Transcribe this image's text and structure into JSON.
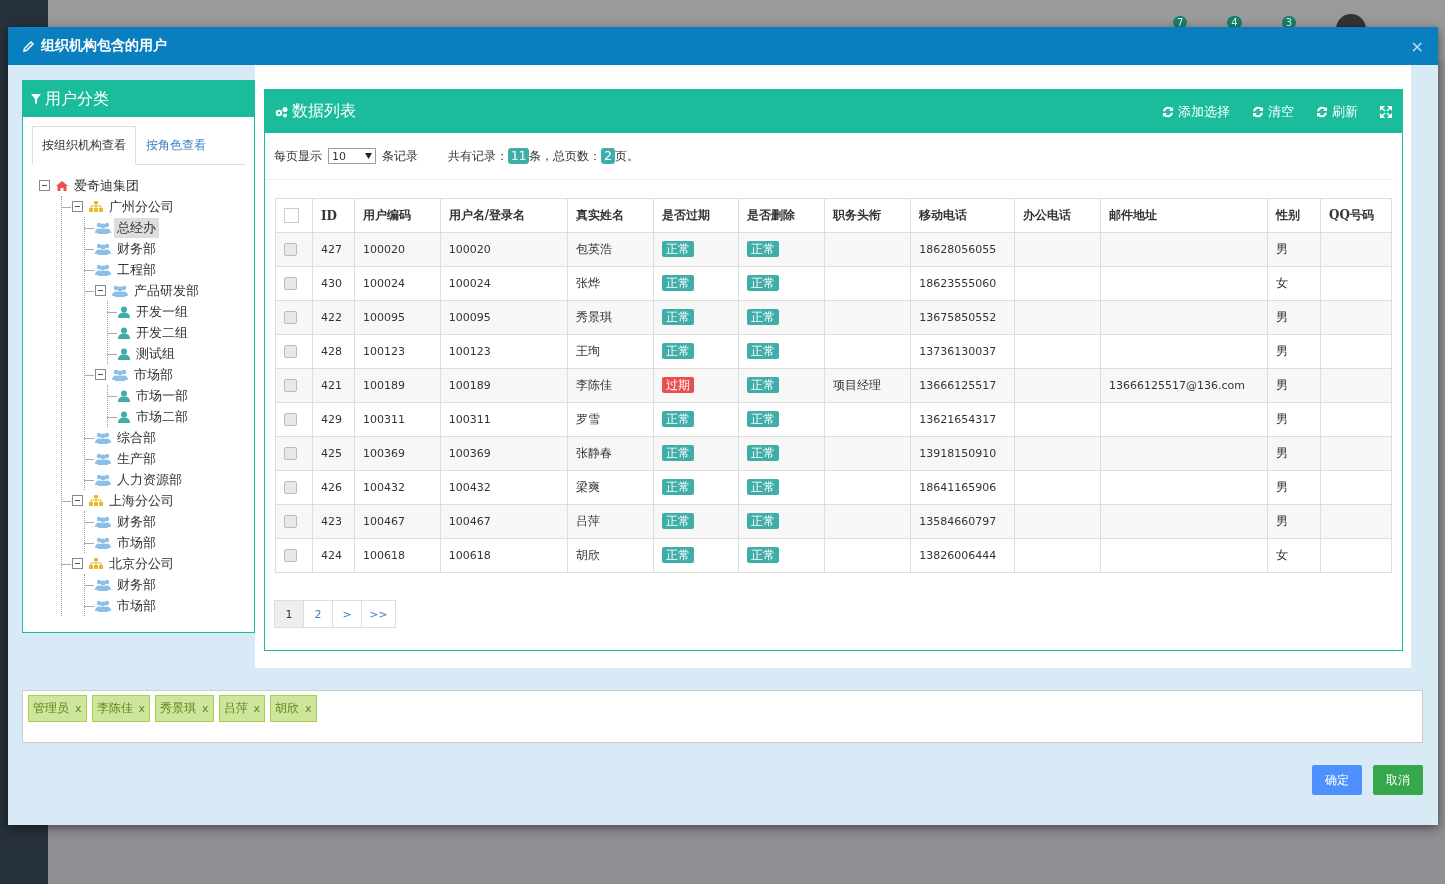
{
  "background_page": {
    "badges": [
      "7",
      "4",
      "3"
    ]
  },
  "dialog": {
    "title": "组织机构包含的用户",
    "close": "×"
  },
  "category_panel": {
    "title": "用户分类",
    "tabs": [
      {
        "label": "按组织机构查看",
        "selected": true
      },
      {
        "label": "按角色查看",
        "selected": false
      }
    ],
    "tree": [
      {
        "label": "爱奇迪集团",
        "kind": "home",
        "selected": false,
        "expanded": true,
        "children": [
          {
            "label": "广州分公司",
            "kind": "org",
            "selected": false,
            "expanded": true,
            "children": [
              {
                "label": "总经办",
                "kind": "dept",
                "selected": true
              },
              {
                "label": "财务部",
                "kind": "dept",
                "selected": false
              },
              {
                "label": "工程部",
                "kind": "dept",
                "selected": false
              },
              {
                "label": "产品研发部",
                "kind": "dept",
                "selected": false,
                "expanded": true,
                "children": [
                  {
                    "label": "开发一组",
                    "kind": "group",
                    "selected": false
                  },
                  {
                    "label": "开发二组",
                    "kind": "group",
                    "selected": false
                  },
                  {
                    "label": "测试组",
                    "kind": "group",
                    "selected": false
                  }
                ]
              },
              {
                "label": "市场部",
                "kind": "dept",
                "selected": false,
                "expanded": true,
                "children": [
                  {
                    "label": "市场一部",
                    "kind": "group",
                    "selected": false
                  },
                  {
                    "label": "市场二部",
                    "kind": "group",
                    "selected": false
                  }
                ]
              },
              {
                "label": "综合部",
                "kind": "dept",
                "selected": false
              },
              {
                "label": "生产部",
                "kind": "dept",
                "selected": false
              },
              {
                "label": "人力资源部",
                "kind": "dept",
                "selected": false
              }
            ]
          },
          {
            "label": "上海分公司",
            "kind": "org",
            "selected": false,
            "expanded": true,
            "children": [
              {
                "label": "财务部",
                "kind": "dept",
                "selected": false
              },
              {
                "label": "市场部",
                "kind": "dept",
                "selected": false
              }
            ]
          },
          {
            "label": "北京分公司",
            "kind": "org",
            "selected": false,
            "expanded": true,
            "children": [
              {
                "label": "财务部",
                "kind": "dept",
                "selected": false
              },
              {
                "label": "市场部",
                "kind": "dept",
                "selected": false
              }
            ]
          }
        ]
      }
    ]
  },
  "data_panel": {
    "title": "数据列表",
    "actions": [
      {
        "label": "添加选择",
        "kind": "refresh"
      },
      {
        "label": "清空",
        "kind": "refresh"
      },
      {
        "label": "刷新",
        "kind": "refresh"
      },
      {
        "kind": "fullscreen"
      }
    ],
    "page_size_label": "每页显示",
    "page_size": "10",
    "records_label": "条记录",
    "total_prefix": "共有记录：",
    "total": "11",
    "total_mid": "条，总页数：",
    "pages": "2",
    "total_suffix": "页。",
    "table": {
      "header_checked": false,
      "columns": [
        "ID",
        "用户编码",
        "用户名/登录名",
        "真实姓名",
        "是否过期",
        "是否删除",
        "职务头衔",
        "移动电话",
        "办公电话",
        "邮件地址",
        "性别",
        "QQ号码"
      ],
      "rows": [
        {
          "checked": false,
          "id": "427",
          "code": "100020",
          "login": "100020",
          "name": "包英浩",
          "expired": {
            "text": "正常",
            "kind": "ok"
          },
          "deleted": {
            "text": "正常",
            "kind": "ok"
          },
          "mobile": "18628056055",
          "gender": "男"
        },
        {
          "checked": false,
          "id": "430",
          "code": "100024",
          "login": "100024",
          "name": "张烨",
          "expired": {
            "text": "正常",
            "kind": "ok"
          },
          "deleted": {
            "text": "正常",
            "kind": "ok"
          },
          "mobile": "18623555060",
          "gender": "女"
        },
        {
          "checked": false,
          "id": "422",
          "code": "100095",
          "login": "100095",
          "name": "秀景琪",
          "expired": {
            "text": "正常",
            "kind": "ok"
          },
          "deleted": {
            "text": "正常",
            "kind": "ok"
          },
          "mobile": "13675850552",
          "gender": "男"
        },
        {
          "checked": false,
          "id": "428",
          "code": "100123",
          "login": "100123",
          "name": "王珣",
          "expired": {
            "text": "正常",
            "kind": "ok"
          },
          "deleted": {
            "text": "正常",
            "kind": "ok"
          },
          "mobile": "13736130037",
          "gender": "男"
        },
        {
          "checked": false,
          "id": "421",
          "code": "100189",
          "login": "100189",
          "name": "李陈佳",
          "expired": {
            "text": "过期",
            "kind": "expired"
          },
          "deleted": {
            "text": "正常",
            "kind": "ok"
          },
          "title": "项目经理",
          "mobile": "13666125517",
          "email": "13666125517@136.com",
          "gender": "男"
        },
        {
          "checked": false,
          "id": "429",
          "code": "100311",
          "login": "100311",
          "name": "罗雪",
          "expired": {
            "text": "正常",
            "kind": "ok"
          },
          "deleted": {
            "text": "正常",
            "kind": "ok"
          },
          "mobile": "13621654317",
          "gender": "男"
        },
        {
          "checked": false,
          "id": "425",
          "code": "100369",
          "login": "100369",
          "name": "张静春",
          "expired": {
            "text": "正常",
            "kind": "ok"
          },
          "deleted": {
            "text": "正常",
            "kind": "ok"
          },
          "mobile": "13918150910",
          "gender": "男"
        },
        {
          "checked": false,
          "id": "426",
          "code": "100432",
          "login": "100432",
          "name": "梁爽",
          "expired": {
            "text": "正常",
            "kind": "ok"
          },
          "deleted": {
            "text": "正常",
            "kind": "ok"
          },
          "mobile": "18641165906",
          "gender": "男"
        },
        {
          "checked": false,
          "id": "423",
          "code": "100467",
          "login": "100467",
          "name": "吕萍",
          "expired": {
            "text": "正常",
            "kind": "ok"
          },
          "deleted": {
            "text": "正常",
            "kind": "ok"
          },
          "mobile": "13584660797",
          "gender": "男"
        },
        {
          "checked": false,
          "id": "424",
          "code": "100618",
          "login": "100618",
          "name": "胡欣",
          "expired": {
            "text": "正常",
            "kind": "ok"
          },
          "deleted": {
            "text": "正常",
            "kind": "ok"
          },
          "mobile": "13826006444",
          "gender": "女"
        }
      ]
    },
    "pagination": [
      {
        "label": "1",
        "selected": true
      },
      {
        "label": "2",
        "selected": false
      },
      {
        "label": ">",
        "selected": false
      },
      {
        "label": ">>",
        "selected": false
      }
    ]
  },
  "selected_users": [
    {
      "name": "管理员",
      "remove": "x"
    },
    {
      "name": "李陈佳",
      "remove": "x"
    },
    {
      "name": "秀景琪",
      "remove": "x"
    },
    {
      "name": "吕萍",
      "remove": "x"
    },
    {
      "name": "胡欣",
      "remove": "x"
    }
  ],
  "buttons": [
    {
      "label": "确定",
      "kind": "primary"
    },
    {
      "label": "取消",
      "kind": "success"
    }
  ]
}
